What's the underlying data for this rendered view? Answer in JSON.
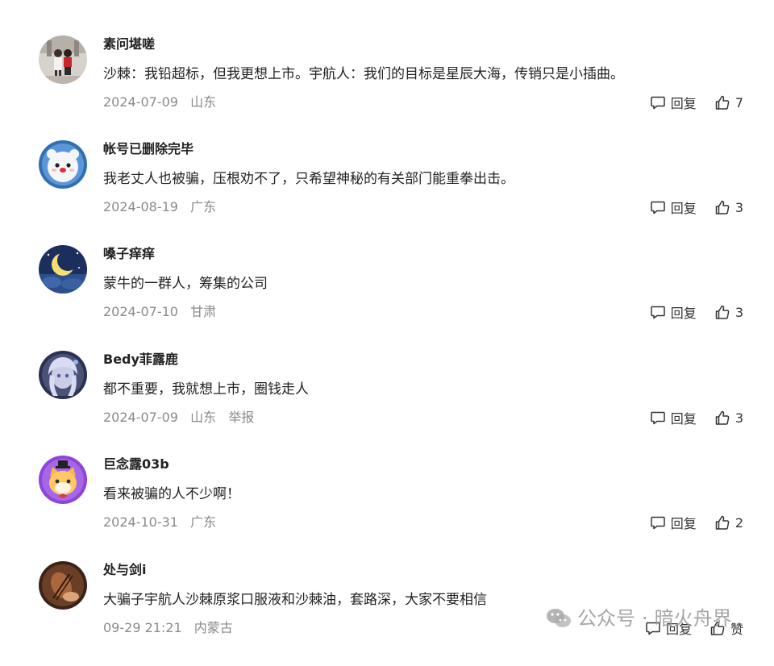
{
  "comments": [
    {
      "username": "素问堪嗟",
      "text": "沙棘：我铅超标，但我更想上市。宇航人：我们的目标是星辰大海，传销只是小插曲。",
      "date": "2024-07-09",
      "location": "山东",
      "report": "",
      "reply_label": "回复",
      "likes": "7"
    },
    {
      "username": "帐号已删除完毕",
      "text": "我老丈人也被骗，压根劝不了，只希望神秘的有关部门能重拳出击。",
      "date": "2024-08-19",
      "location": "广东",
      "report": "",
      "reply_label": "回复",
      "likes": "3"
    },
    {
      "username": "嗓子痒痒",
      "text": "蒙牛的一群人，筹集的公司",
      "date": "2024-07-10",
      "location": "甘肃",
      "report": "",
      "reply_label": "回复",
      "likes": "3"
    },
    {
      "username": "Bedy菲露鹿",
      "text": "都不重要，我就想上市，圈钱走人",
      "date": "2024-07-09",
      "location": "山东",
      "report": "举报",
      "reply_label": "回复",
      "likes": "3"
    },
    {
      "username": "巨念露03b",
      "text": "看来被骗的人不少啊！",
      "date": "2024-10-31",
      "location": "广东",
      "report": "",
      "reply_label": "回复",
      "likes": "2"
    },
    {
      "username": "处与剑i",
      "text": "大骗子宇航人沙棘原浆口服液和沙棘油，套路深，大家不要相信",
      "date": "09-29 21:21",
      "location": "内蒙古",
      "report": "",
      "reply_label": "回复",
      "likes": "赞"
    }
  ],
  "watermark": {
    "left": "公众号",
    "right": "暗火舟界",
    "icon": "wechat-icon"
  },
  "colors": {
    "text": "#222222",
    "meta": "#8a8a8a",
    "background": "#ffffff"
  }
}
